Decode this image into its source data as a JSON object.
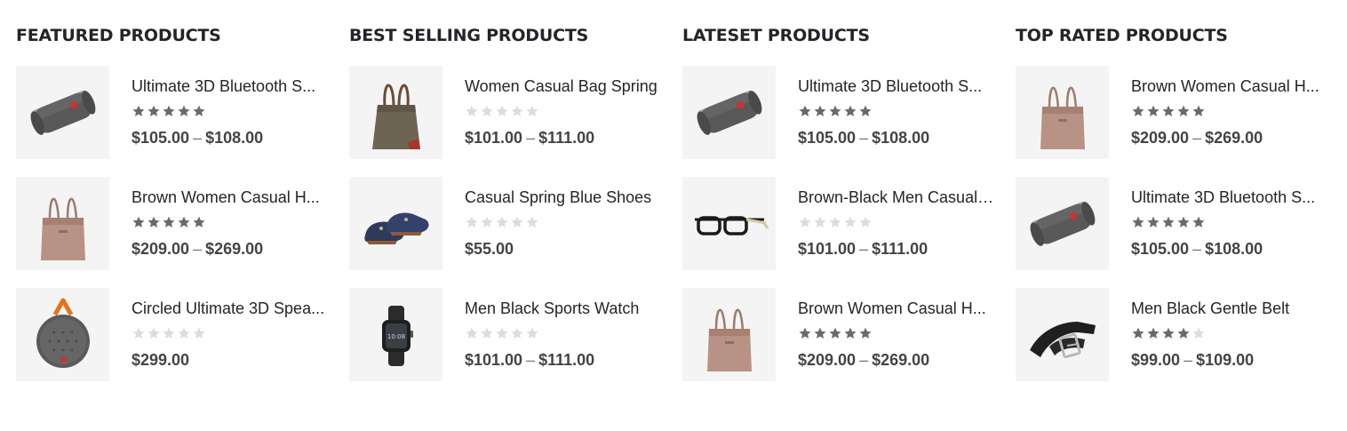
{
  "columns": [
    {
      "title": "FEATURED PRODUCTS",
      "items": [
        {
          "name": "Ultimate 3D Bluetooth S...",
          "rating": 5,
          "price_from": "$105.00",
          "price_to": "$108.00",
          "image": "speaker-image"
        },
        {
          "name": "Brown Women Casual H...",
          "rating": 5,
          "price_from": "$209.00",
          "price_to": "$269.00",
          "image": "handbag-image"
        },
        {
          "name": "Circled Ultimate 3D Spea...",
          "rating": 0,
          "price_from": "$299.00",
          "price_to": "",
          "image": "round-speaker-image"
        }
      ]
    },
    {
      "title": "BEST SELLING PRODUCTS",
      "items": [
        {
          "name": "Women Casual Bag Spring",
          "rating": 0,
          "price_from": "$101.00",
          "price_to": "$111.00",
          "image": "tote-bag-image"
        },
        {
          "name": "Casual Spring Blue Shoes",
          "rating": 0,
          "price_from": "$55.00",
          "price_to": "",
          "image": "shoes-image"
        },
        {
          "name": "Men Black Sports Watch",
          "rating": 0,
          "price_from": "$101.00",
          "price_to": "$111.00",
          "image": "watch-image"
        }
      ]
    },
    {
      "title": "LATESET PRODUCTS",
      "items": [
        {
          "name": "Ultimate 3D Bluetooth S...",
          "rating": 5,
          "price_from": "$105.00",
          "price_to": "$108.00",
          "image": "speaker-image"
        },
        {
          "name": "Brown-Black Men Casual ...",
          "rating": 0,
          "price_from": "$101.00",
          "price_to": "$111.00",
          "image": "glasses-image"
        },
        {
          "name": "Brown Women Casual H...",
          "rating": 5,
          "price_from": "$209.00",
          "price_to": "$269.00",
          "image": "handbag-image"
        }
      ]
    },
    {
      "title": "TOP RATED PRODUCTS",
      "items": [
        {
          "name": "Brown Women Casual H...",
          "rating": 5,
          "price_from": "$209.00",
          "price_to": "$269.00",
          "image": "handbag-image"
        },
        {
          "name": "Ultimate 3D Bluetooth S...",
          "rating": 5,
          "price_from": "$105.00",
          "price_to": "$108.00",
          "image": "speaker-image"
        },
        {
          "name": "Men Black Gentle Belt",
          "rating": 4,
          "price_from": "$99.00",
          "price_to": "$109.00",
          "image": "belt-image"
        }
      ]
    }
  ],
  "colors": {
    "star_filled": "#6a6a6a",
    "star_empty": "#dcdcdc",
    "thumb_bg": "#f4f4f4",
    "title": "#222529",
    "price": "#444444"
  },
  "price_separator": "–"
}
